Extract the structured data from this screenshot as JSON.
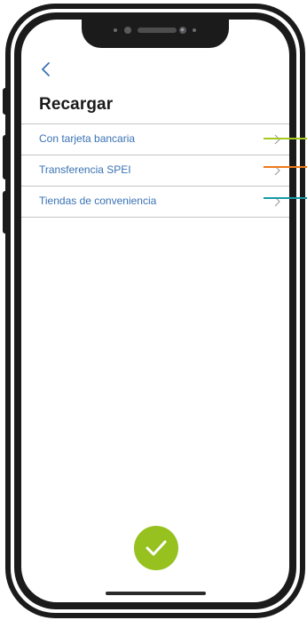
{
  "screen": {
    "title": "Recargar",
    "menu_items": [
      {
        "label": "Con tarjeta bancaria"
      },
      {
        "label": "Transferencia SPEI"
      },
      {
        "label": "Tiendas de conveniencia"
      }
    ]
  },
  "colors": {
    "accent_link": "#3a72b4",
    "confirm_green": "#96c11f",
    "callout_green": "#a6c920",
    "callout_orange": "#ee7a1a",
    "callout_teal": "#169aa6"
  },
  "icons": {
    "back": "chevron-left-icon",
    "row": "chevron-right-icon",
    "confirm": "checkmark-icon"
  }
}
